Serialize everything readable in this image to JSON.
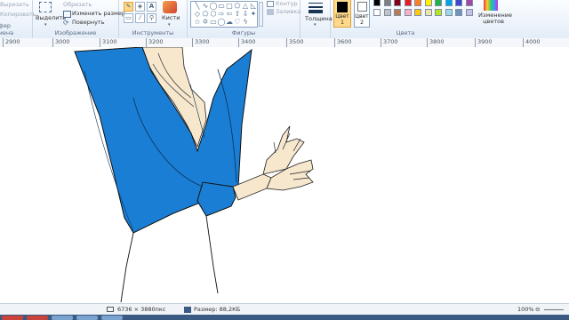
{
  "ribbon": {
    "groups": {
      "clipboard": "Буфер обмена",
      "image": "Изображение",
      "tools": "Инструменты",
      "shapes": "Фигуры",
      "colors": "Цвета"
    },
    "clipboard_items": [
      "Вырезать",
      "Копировать"
    ],
    "image": {
      "select": "Выделить",
      "crop": "Обрезать",
      "resize": "Изменить размер",
      "rotate": "Повернуть"
    },
    "brushes": "Кисти",
    "outline": "Контур",
    "fill": "Заливка",
    "thickness": "Толщина",
    "color1": "Цвет\n1",
    "color2": "Цвет\n2",
    "edit_colors": "Изменение цветов"
  },
  "ruler": {
    "marks": [
      "2900",
      "3000",
      "3100",
      "3200",
      "3300",
      "3400",
      "3500",
      "3600",
      "3700",
      "3800",
      "3900",
      "4000"
    ]
  },
  "status": {
    "dimensions": "6736 × 3880пкс",
    "size": "Размер: 88,2КБ",
    "zoom": "100%"
  },
  "palette": [
    "#000000",
    "#7f7f7f",
    "#880015",
    "#ed1c24",
    "#ff7f27",
    "#fff200",
    "#22b14c",
    "#00a2e8",
    "#3f48cc",
    "#a349a4",
    "#ffffff",
    "#c3c3c3",
    "#b97a57",
    "#ffaec9",
    "#ffc90e",
    "#efe4b0",
    "#b5e61d",
    "#99d9ea",
    "#7092be",
    "#c8bfe7"
  ],
  "colors": {
    "primary": "#000000",
    "secondary": "#ffffff",
    "jacket": "#1a7fd4",
    "skin": "#f6e7cd",
    "ribbon_bg": "#e3edf8"
  }
}
